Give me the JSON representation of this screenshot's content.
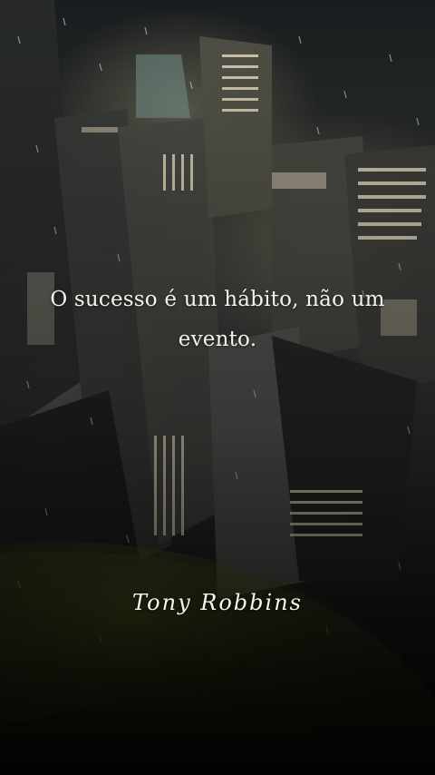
{
  "quote": {
    "text": "O sucesso é um hábito, não um evento."
  },
  "author": {
    "name": "Tony Robbins"
  },
  "colors": {
    "text": "#f4f2ec",
    "overlay_green": "#5a6a1e",
    "night_sky": "#0d1012"
  }
}
